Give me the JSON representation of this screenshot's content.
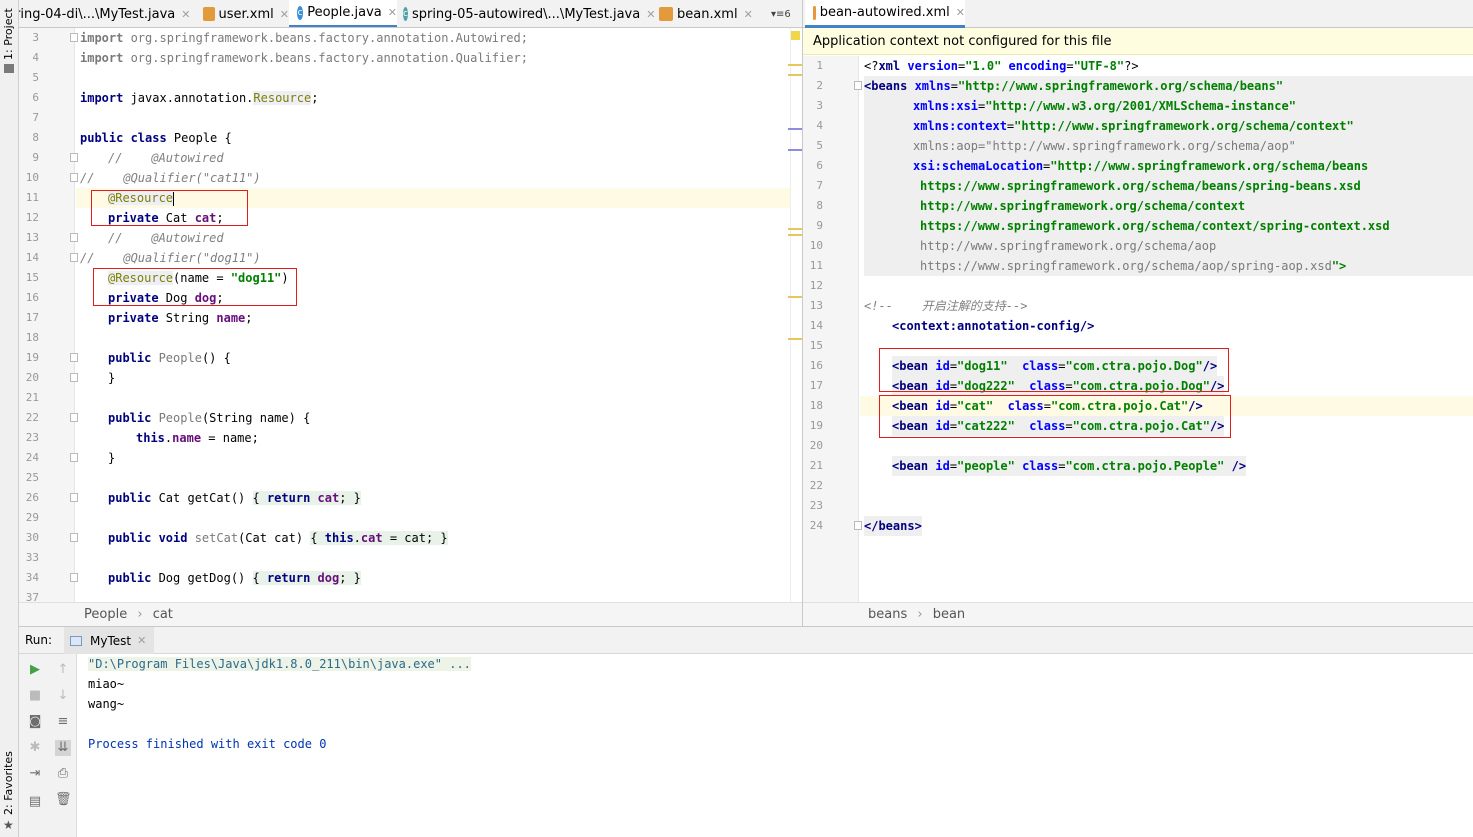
{
  "sidebar": {
    "project_label": "1: Project",
    "favorites_label": "2: Favorites"
  },
  "left_tabs": [
    {
      "label": "ring-04-di\\...\\MyTest.java",
      "icon": "java-class-icon"
    },
    {
      "label": "user.xml",
      "icon": "xml-file-icon"
    },
    {
      "label": "People.java",
      "icon": "class-icon"
    },
    {
      "label": "spring-05-autowired\\...\\MyTest.java",
      "icon": "java-class-icon"
    },
    {
      "label": "bean.xml",
      "icon": "xml-file-icon"
    }
  ],
  "left_tabs_more": "6",
  "right_tabs": [
    {
      "label": "bean-autowired.xml",
      "icon": "xml-file-icon"
    }
  ],
  "left_editor": {
    "line_numbers": [
      "3",
      "4",
      "5",
      "6",
      "7",
      "8",
      "9",
      "10",
      "11",
      "12",
      "13",
      "14",
      "15",
      "16",
      "17",
      "18",
      "19",
      "20",
      "21",
      "22",
      "23",
      "24",
      "25",
      "26",
      "29",
      "30",
      "33",
      "34",
      "37"
    ],
    "lines": {
      "l3a": "import ",
      "l3b": "org.springframework.beans.factory.annotation.Autowired;",
      "l4a": "import ",
      "l4b": "org.springframework.beans.factory.annotation.Qualifier;",
      "l6a": "import ",
      "l6b": "javax.annotation.",
      "l6c": "Resource",
      "l6d": ";",
      "l8a": "public class ",
      "l8b": "People {",
      "l9": "//    @Autowired",
      "l10": "//    @Qualifier(\"cat11\")",
      "l11": "@Resource",
      "l12a": "private ",
      "l12b": "Cat ",
      "l12c": "cat",
      "l12d": ";",
      "l13": "//    @Autowired",
      "l14": "//    @Qualifier(\"dog11\")",
      "l15a": "@Resource",
      "l15b": "(name = ",
      "l15c": "\"dog11\"",
      "l15d": ")",
      "l16a": "private ",
      "l16b": "Dog ",
      "l16c": "dog",
      "l16d": ";",
      "l17a": "private ",
      "l17b": "String ",
      "l17c": "name",
      "l17d": ";",
      "l19a": "public ",
      "l19b": "People",
      "l19c": "() {",
      "l20": "}",
      "l22a": "public ",
      "l22b": "People",
      "l22c": "(String name) {",
      "l23a": "this",
      "l23b": ".",
      "l23c": "name",
      "l23d": " = name;",
      "l24": "}",
      "l26a": "public ",
      "l26b": "Cat getCat() ",
      "l26c": "{ ",
      "l26d": "return ",
      "l26e": "cat",
      "l26f": "; }",
      "l30a": "public void ",
      "l30b": "setCat",
      "l30c": "(Cat cat) ",
      "l30d": "{ ",
      "l30e": "this",
      "l30f": ".",
      "l30g": "cat",
      "l30h": " = cat; }",
      "l34a": "public ",
      "l34b": "Dog getDog() ",
      "l34c": "{ ",
      "l34d": "return ",
      "l34e": "dog",
      "l34f": "; }"
    }
  },
  "right_editor": {
    "warning": "Application context not configured for this file",
    "line_numbers": [
      "1",
      "2",
      "3",
      "4",
      "5",
      "6",
      "7",
      "8",
      "9",
      "10",
      "11",
      "12",
      "13",
      "14",
      "15",
      "16",
      "17",
      "18",
      "19",
      "20",
      "21",
      "22",
      "23",
      "24"
    ],
    "lines": {
      "r1a": "<?",
      "r1b": "xml ",
      "r1c": "version",
      "r1d": "=",
      "r1e": "\"1.0\" ",
      "r1f": "encoding",
      "r1g": "=",
      "r1h": "\"UTF-8\"",
      "r1i": "?>",
      "r2a": "<beans ",
      "r2b": "xmlns",
      "r2c": "=",
      "r2d": "\"http://www.springframework.org/schema/beans\"",
      "r3a": "xmlns:xsi",
      "r3b": "=",
      "r3c": "\"http://www.w3.org/2001/XMLSchema-instance\"",
      "r4a": "xmlns:context",
      "r4b": "=",
      "r4c": "\"http://www.springframework.org/schema/context\"",
      "r5": "xmlns:aop=\"http://www.springframework.org/schema/aop\"",
      "r6a": "xsi:schemaLocation",
      "r6b": "=",
      "r6c": "\"http://www.springframework.org/schema/beans",
      "r7": "https://www.springframework.org/schema/beans/spring-beans.xsd",
      "r8": "http://www.springframework.org/schema/context",
      "r9": "https://www.springframework.org/schema/context/spring-context.xsd",
      "r10": "http://www.springframework.org/schema/aop",
      "r11a": "https://www.springframework.org/schema/aop/spring-aop.xsd",
      "r11b": "\">",
      "r13": "<!--    开启注解的支持-->",
      "r14a": "<context:annotation-config",
      "r14b": "/>",
      "r16a": "<bean ",
      "r16b": "id",
      "r16c": "=",
      "r16d": "\"dog11\"  ",
      "r16e": "class",
      "r16f": "=",
      "r16g": "\"com.ctra.pojo.Dog\"",
      "r16h": "/>",
      "r17a": "<bean ",
      "r17b": "id",
      "r17c": "=",
      "r17d": "\"dog222\"  ",
      "r17e": "class",
      "r17f": "=",
      "r17g": "\"com.ctra.pojo.Dog\"",
      "r17h": "/>",
      "r18a": "<bean ",
      "r18b": "id",
      "r18c": "=",
      "r18d": "\"cat\"  ",
      "r18e": "class",
      "r18f": "=",
      "r18g": "\"com.ctra.pojo.Cat\"",
      "r18h": "/>",
      "r19a": "<bean ",
      "r19b": "id",
      "r19c": "=",
      "r19d": "\"cat222\"  ",
      "r19e": "class",
      "r19f": "=",
      "r19g": "\"com.ctra.pojo.Cat\"",
      "r19h": "/>",
      "r21a": "<bean ",
      "r21b": "id",
      "r21c": "=",
      "r21d": "\"people\" ",
      "r21e": "class",
      "r21f": "=",
      "r21g": "\"com.ctra.pojo.People\"",
      "r21h": " />",
      "r24": "</beans>"
    }
  },
  "breadcrumbs_left": [
    "People",
    "cat"
  ],
  "breadcrumbs_right": [
    "beans",
    "bean"
  ],
  "breadcrumb_separator": "›",
  "run": {
    "label": "Run:",
    "tab": "MyTest",
    "output": [
      "\"D:\\Program Files\\Java\\jdk1.8.0_211\\bin\\java.exe\" ...",
      "miao~",
      "wang~",
      "",
      "Process finished with exit code 0"
    ]
  }
}
